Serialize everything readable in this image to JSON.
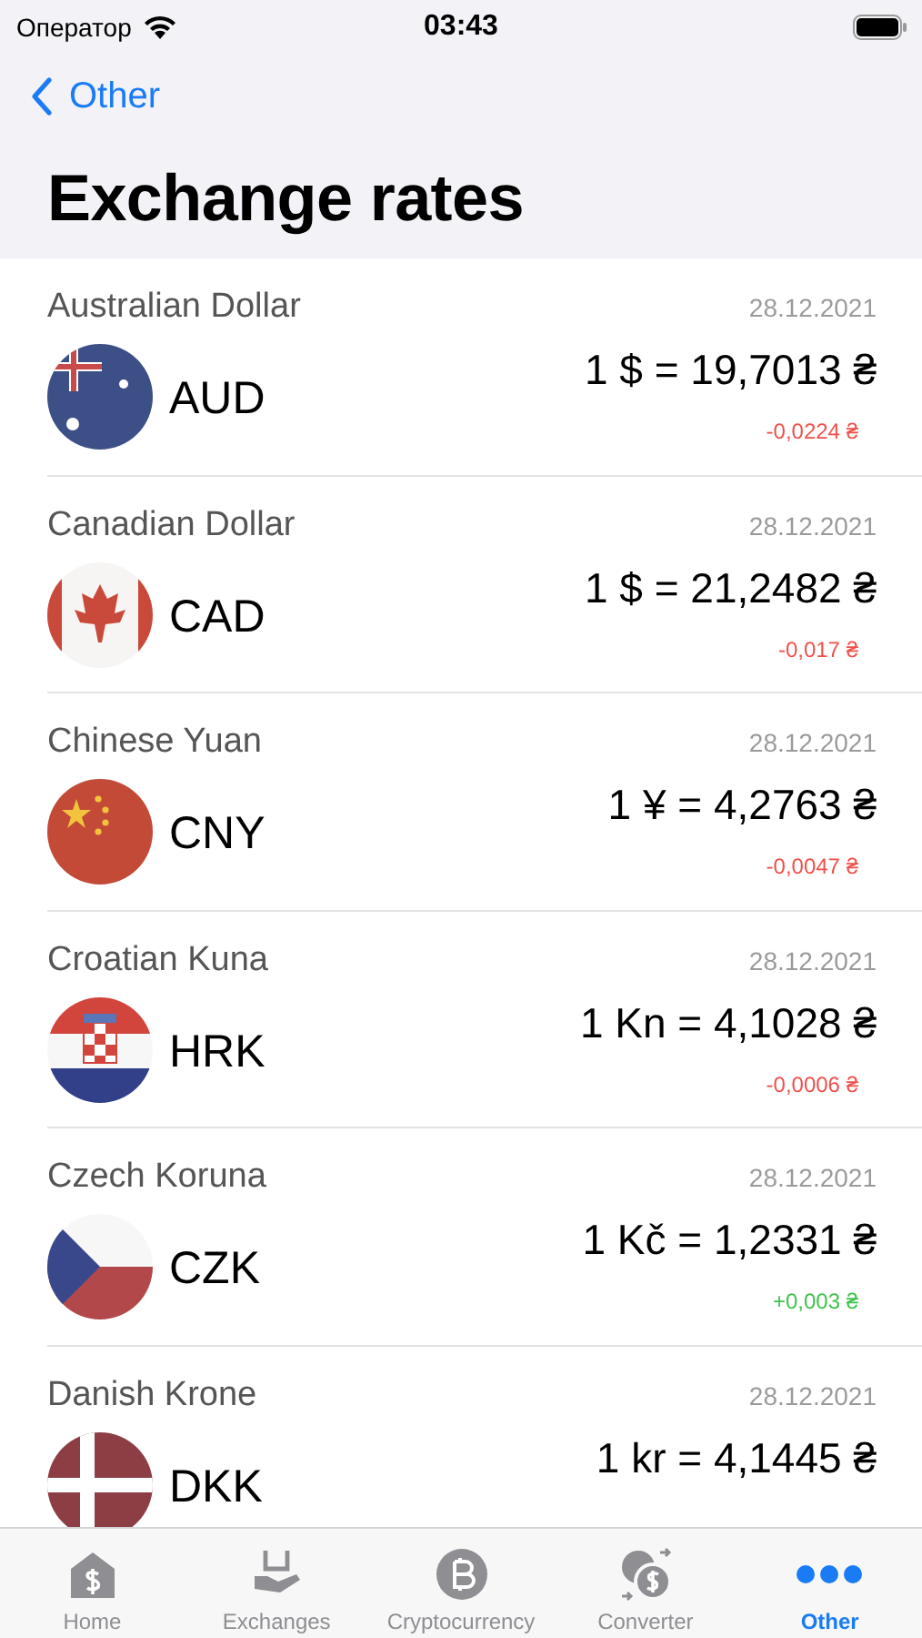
{
  "status_bar": {
    "carrier": "Оператор",
    "time": "03:43"
  },
  "nav": {
    "back": "Other",
    "title": "Exchange rates"
  },
  "rates": [
    {
      "name": "Australian Dollar",
      "date": "28.12.2021",
      "code": "AUD",
      "rate": "1 $ = 19,7013 ₴",
      "change": "-0,0224 ₴",
      "rising": false
    },
    {
      "name": "Canadian Dollar",
      "date": "28.12.2021",
      "code": "CAD",
      "rate": "1 $ = 21,2482 ₴",
      "change": "-0,017 ₴",
      "rising": false
    },
    {
      "name": "Chinese Yuan",
      "date": "28.12.2021",
      "code": "CNY",
      "rate": "1 ¥ = 4,2763 ₴",
      "change": "-0,0047 ₴",
      "rising": false
    },
    {
      "name": "Croatian Kuna",
      "date": "28.12.2021",
      "code": "HRK",
      "rate": "1 Kn = 4,1028 ₴",
      "change": "-0,0006 ₴",
      "rising": false
    },
    {
      "name": "Czech Koruna",
      "date": "28.12.2021",
      "code": "CZK",
      "rate": "1 Kč = 1,2331 ₴",
      "change": "+0,003 ₴",
      "rising": true
    },
    {
      "name": "Danish Krone",
      "date": "28.12.2021",
      "code": "DKK",
      "rate": "1 kr = 4,1445 ₴"
    }
  ],
  "tabs": [
    {
      "label": "Home",
      "selected": false
    },
    {
      "label": "Exchanges",
      "selected": false
    },
    {
      "label": "Cryptocurrency",
      "selected": false
    },
    {
      "label": "Converter",
      "selected": false
    },
    {
      "label": "Other",
      "selected": true
    }
  ]
}
